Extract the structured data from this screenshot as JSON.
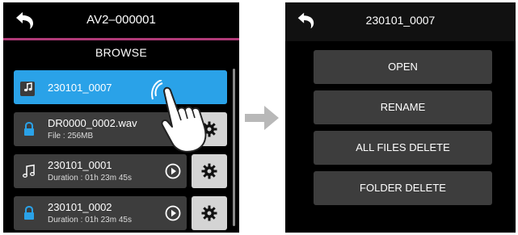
{
  "left_screen": {
    "title": "AV2–000001",
    "subtitle": "BROWSE",
    "items": [
      {
        "name": "230101_0007",
        "icon": "music-note-icon",
        "selected": true
      },
      {
        "name": "DR0000_0002.wav",
        "detail": "File : 256MB",
        "icon": "lock-icon"
      },
      {
        "name": "230101_0001",
        "detail": "Duration : 01h 23m 45s",
        "icon": "music-note-icon"
      },
      {
        "name": "230101_0002",
        "detail": "Duration : 01h 23m 45s",
        "icon": "lock-icon"
      }
    ]
  },
  "right_screen": {
    "title": "230101_0007",
    "menu": [
      "OPEN",
      "RENAME",
      "ALL FILES DELETE",
      "FOLDER DELETE"
    ]
  },
  "colors": {
    "selected": "#2aa2e8",
    "accent_line": "#b03a78",
    "item_bg": "#3d3d3d",
    "gear_bg": "#d4d4d4"
  }
}
